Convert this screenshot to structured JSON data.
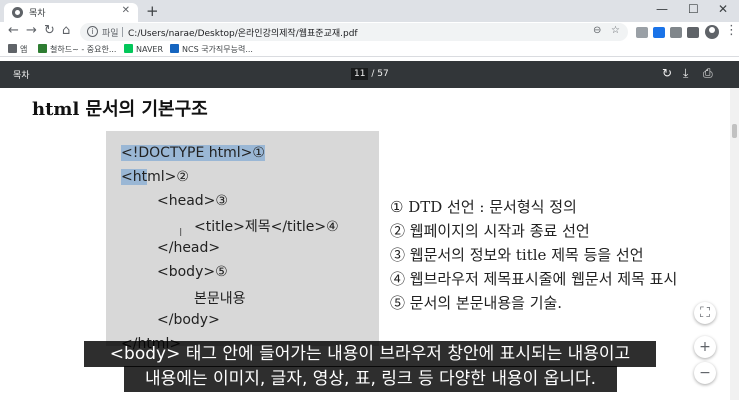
{
  "browser": {
    "tab_title": "목차",
    "tab_close": "✕",
    "new_tab": "+",
    "window_controls": {
      "minimize": "—",
      "maximize": "☐",
      "close": "✕"
    }
  },
  "toolbar": {
    "back": "←",
    "forward": "→",
    "reload": "↻",
    "home": "⌂",
    "info": "i",
    "file_label": "파일",
    "url": "C:/Users/narae/Desktop/온라인강의제작/웹표준교재.pdf",
    "zoom_icon": "⊖",
    "star_icon": "☆",
    "menu": "⋮"
  },
  "bookmarks": [
    {
      "label": "앱",
      "color": "#5f6368"
    },
    {
      "label": "철하드~ - 중요한...",
      "color": "#2e7d32"
    },
    {
      "label": "NAVER",
      "color": "#03c75a"
    },
    {
      "label": "NCS 국가직무능력...",
      "color": "#1565c0"
    }
  ],
  "pdf_viewer": {
    "title": "목차",
    "current_page": "11",
    "page_separator": "/",
    "total_pages": "57",
    "rotate_icon": "↻",
    "download_icon": "⤓",
    "print_icon": "⎙"
  },
  "page": {
    "heading": "html 문서의 기본구조",
    "code_lines": [
      {
        "highlight": "<!DOCTYPE html>①",
        "rest": ""
      },
      {
        "highlight": "<ht",
        "rest": "ml>②"
      },
      {
        "highlight": "",
        "rest": "<head>③"
      },
      {
        "highlight": "",
        "rest": "<title>제목</title>④"
      },
      {
        "highlight": "",
        "rest": "</head>"
      },
      {
        "highlight": "",
        "rest": "<body>⑤"
      },
      {
        "highlight": "",
        "rest": "본문내용"
      },
      {
        "highlight": "",
        "rest": "</body>"
      },
      {
        "highlight": "",
        "rest": "</html>"
      }
    ],
    "legend": [
      "① DTD 선언 : 문서형식 정의",
      "② 웹페이지의 시작과 종료 선언",
      "③ 웹문서의 정보와 title 제목 등을 선언",
      "④ 웹브라우저 제목표시줄에 웹문서 제목 표시",
      "⑤ 문서의 본문내용을 기술."
    ]
  },
  "zoom_controls": {
    "fit": "⛶",
    "zoom_in": "+",
    "zoom_out": "−"
  },
  "subtitles": {
    "line1": "<body> 태그 안에 들어가는 내용이 브라우저 창안에 표시되는 내용이고",
    "line2": "내용에는 이미지, 글자, 영상, 표, 링크 등 다양한 내용이 옵니다."
  }
}
